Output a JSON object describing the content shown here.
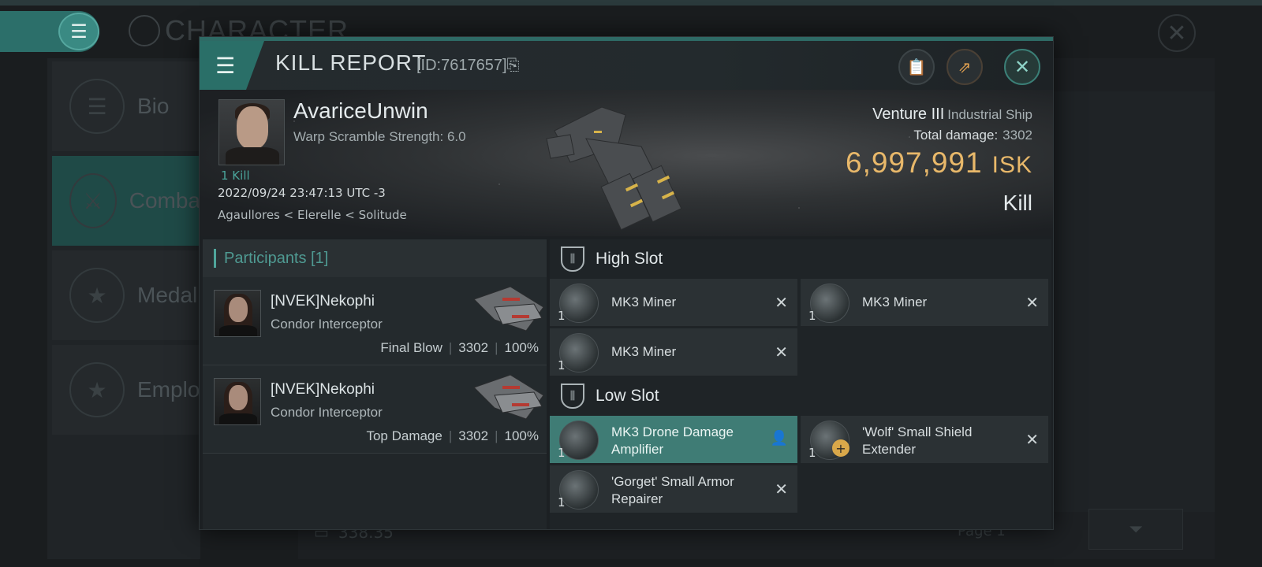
{
  "background": {
    "title": "CHARACTER",
    "side_items": [
      {
        "label": "Bio",
        "icon": "bars-icon"
      },
      {
        "label": "Comba",
        "icon": "crossed-swords-icon"
      },
      {
        "label": "Medal",
        "icon": "star-badge-icon"
      },
      {
        "label": "Emplo",
        "icon": "star-circle-icon"
      }
    ],
    "bottom_value": "338.35",
    "page": "Page 1"
  },
  "header": {
    "title": "KILL REPORT",
    "id": "[ID:7617657]"
  },
  "victim": {
    "name": "AvariceUnwin",
    "subtitle": "Warp Scramble Strength: 6.0",
    "kills": "1 Kill",
    "timestamp": "2022/09/24 23:47:13 UTC -3",
    "location": "Agaullores < Elerelle < Solitude"
  },
  "ship": {
    "name": "Venture III",
    "class": "Industrial Ship",
    "total_damage_label": "Total damage:",
    "total_damage": "3302",
    "value": "6,997,991",
    "currency": "ISK",
    "outcome": "Kill"
  },
  "participants": {
    "title": "Participants [1]",
    "rows": [
      {
        "name": "[NVEK]Nekophi",
        "ship": "Condor Interceptor",
        "tag": "Final Blow",
        "damage": "3302",
        "pct": "100%"
      },
      {
        "name": "[NVEK]Nekophi",
        "ship": "Condor Interceptor",
        "tag": "Top Damage",
        "damage": "3302",
        "pct": "100%"
      }
    ]
  },
  "high_slot": {
    "title": "High Slot",
    "modules": [
      {
        "name": "MK3 Miner",
        "qty": "1"
      },
      {
        "name": "MK3 Miner",
        "qty": "1"
      },
      {
        "name": "MK3 Miner",
        "qty": "1"
      }
    ]
  },
  "low_slot": {
    "title": "Low Slot",
    "modules": [
      {
        "name": "MK3 Drone Damage Amplifier",
        "qty": "1"
      },
      {
        "name": "'Wolf' Small Shield Extender",
        "qty": "1"
      },
      {
        "name": "'Gorget' Small Armor Repairer",
        "qty": "1"
      }
    ]
  },
  "colors": {
    "accent": "#2e6a65",
    "isk": "#e8b86a",
    "highlight_row": "#3f7c75"
  }
}
